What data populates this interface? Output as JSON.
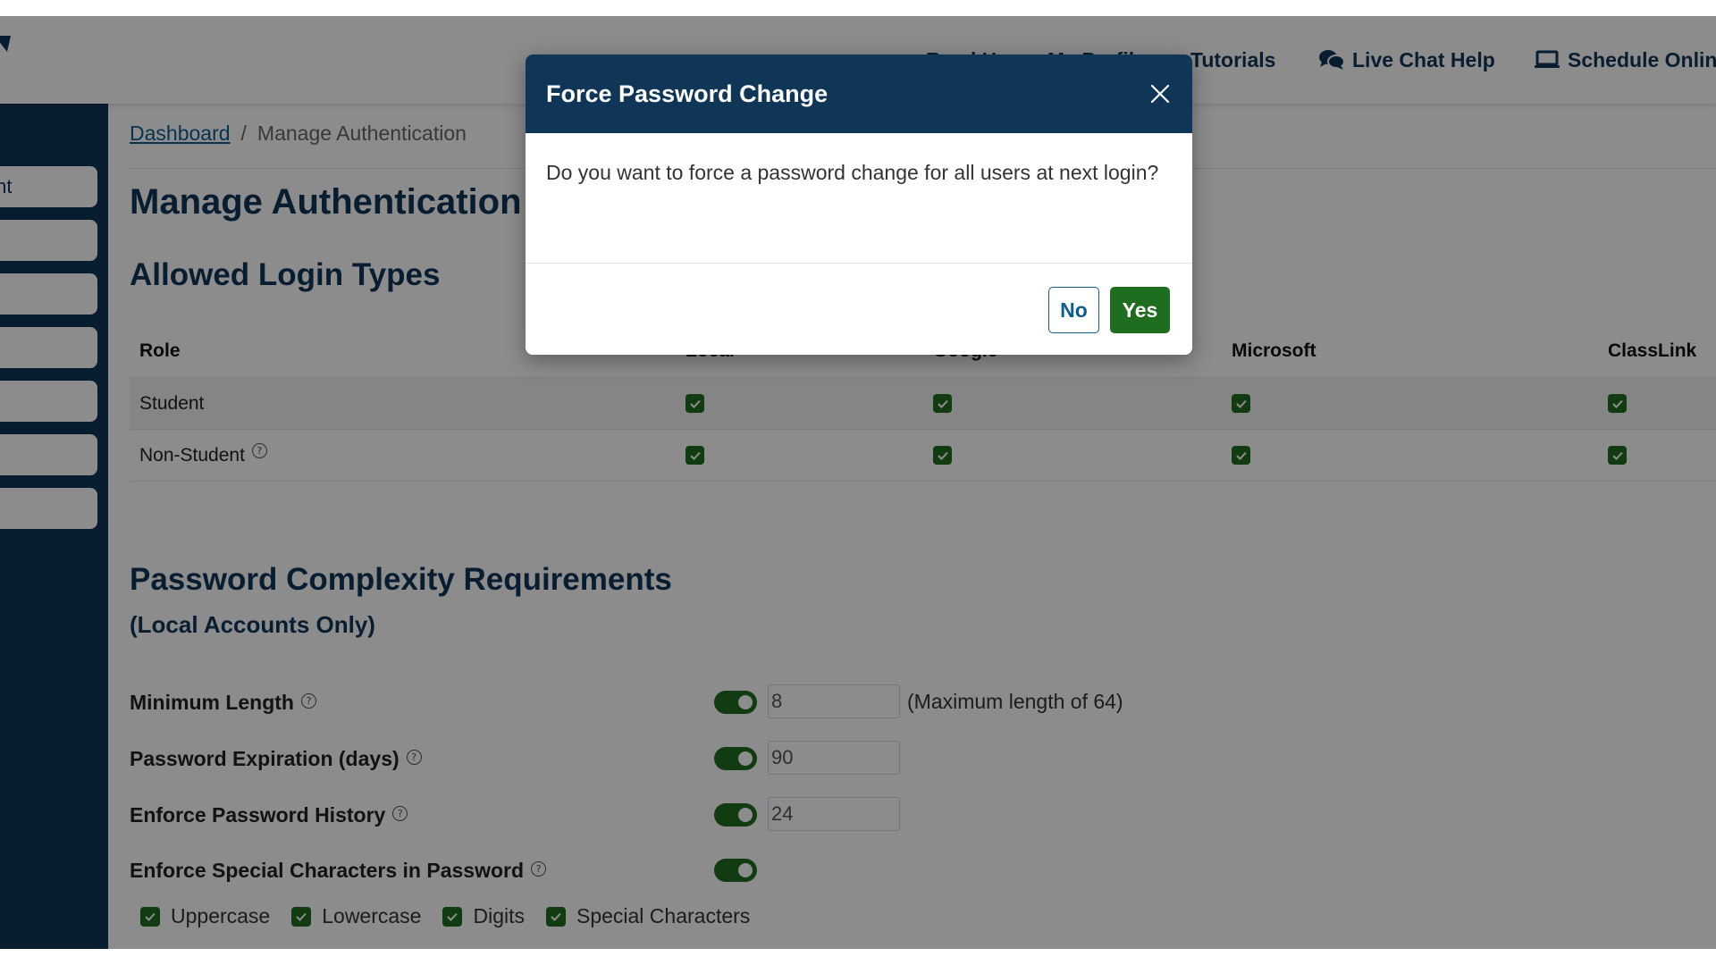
{
  "header": {
    "nav": [
      {
        "label": "Read Here",
        "icon": "book-icon"
      },
      {
        "label": "My Profile",
        "icon": "user-icon"
      },
      {
        "label": "Tutorials",
        "icon": "video-icon"
      },
      {
        "label": "Live Chat Help",
        "icon": "chat-bubbles-icon"
      },
      {
        "label": "Schedule Online",
        "icon": "laptop-icon"
      }
    ]
  },
  "sidebar": {
    "items": [
      {
        "label": "Account"
      },
      {
        "label": ""
      },
      {
        "label": ""
      },
      {
        "label": ""
      },
      {
        "label": ""
      },
      {
        "label": ""
      },
      {
        "label": ""
      }
    ]
  },
  "breadcrumb": {
    "home": "Dashboard",
    "separator": "/",
    "current": "Manage Authentication"
  },
  "page_title": "Manage Authentication",
  "login_types": {
    "heading": "Allowed Login Types",
    "columns": [
      "Role",
      "Local",
      "Google",
      "Microsoft",
      "ClassLink"
    ],
    "rows": [
      {
        "role": "Student",
        "local": true,
        "google": true,
        "microsoft": true,
        "classlink": true
      },
      {
        "role": "Non-Student",
        "local": true,
        "google": true,
        "microsoft": true,
        "classlink": true
      }
    ]
  },
  "password": {
    "heading": "Password Complexity Requirements",
    "subheading": "(Local Accounts Only)",
    "settings": [
      {
        "label": "Minimum Length",
        "enabled": true,
        "value": "8",
        "note": "(Maximum length of 64)"
      },
      {
        "label": "Password Expiration (days)",
        "enabled": true,
        "value": "90"
      },
      {
        "label": "Enforce Password History",
        "enabled": true,
        "value": "24"
      },
      {
        "label": "Enforce Special Characters in Password",
        "enabled": true
      }
    ],
    "character_types": [
      {
        "label": "Uppercase",
        "checked": true
      },
      {
        "label": "Lowercase",
        "checked": true
      },
      {
        "label": "Digits",
        "checked": true
      },
      {
        "label": "Special Characters",
        "checked": true
      }
    ]
  },
  "modal": {
    "title": "Force Password Change",
    "message": "Do you want to force a password change for all users at next login?",
    "no_label": "No",
    "yes_label": "Yes"
  },
  "colors": {
    "navy": "#0f3557",
    "link": "#0f5d8c",
    "green": "#1f6e1f",
    "overlay": "rgba(0,0,0,0.45)"
  }
}
